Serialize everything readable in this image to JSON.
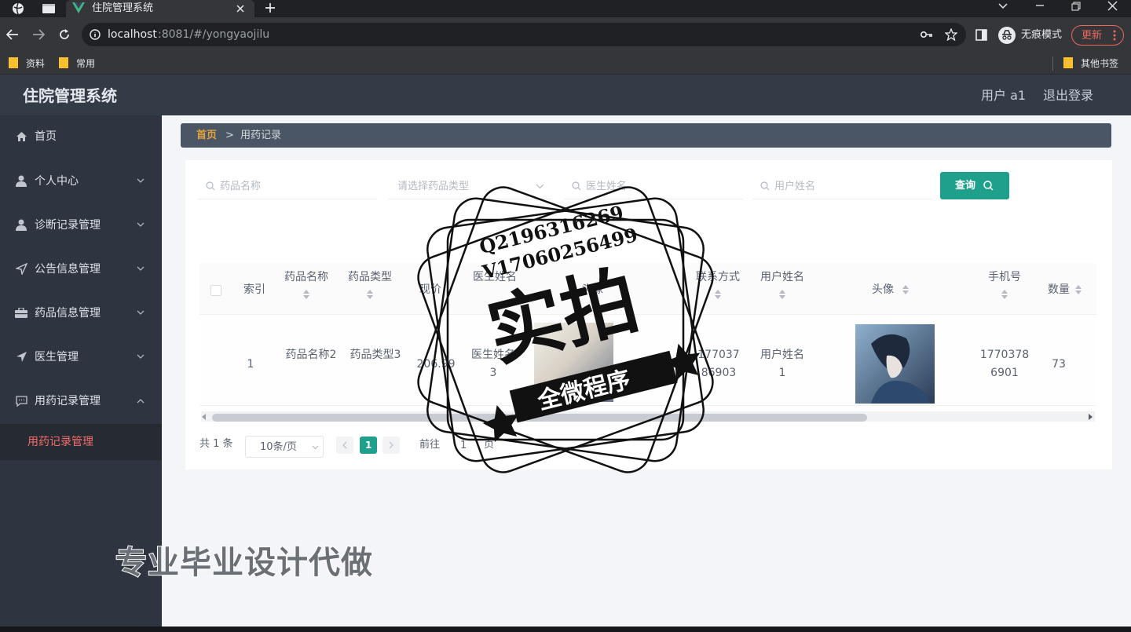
{
  "browser": {
    "tab_title": "住院管理系统",
    "url_host": "localhost",
    "url_rest": ":8081/#/yongyaojilu",
    "incognito_label": "无痕模式",
    "update_label": "更新",
    "bookmarks": [
      "资料",
      "常用"
    ],
    "other_bookmarks": "其他书签",
    "icons": [
      "globe-icon",
      "window-icon",
      "vue-logo-icon",
      "close-tab-icon",
      "new-tab-icon",
      "minimize-icon",
      "restore-icon",
      "close-window-icon",
      "back-icon",
      "forward-icon",
      "reload-icon",
      "info-icon",
      "key-icon",
      "star-icon",
      "sidebar-icon",
      "incognito-icon",
      "more-icon",
      "folder-icon"
    ]
  },
  "app": {
    "title": "住院管理系统",
    "user_label": "用户 a1",
    "logout_label": "退出登录"
  },
  "sidebar": {
    "items": [
      {
        "label": "首页",
        "icon": "home-icon"
      },
      {
        "label": "个人中心",
        "icon": "user-icon"
      },
      {
        "label": "诊断记录管理",
        "icon": "user-icon"
      },
      {
        "label": "公告信息管理",
        "icon": "send-icon"
      },
      {
        "label": "药品信息管理",
        "icon": "briefcase-icon"
      },
      {
        "label": "医生管理",
        "icon": "plane-icon"
      },
      {
        "label": "用药记录管理",
        "icon": "chat-icon"
      }
    ],
    "sub_item": "用药记录管理",
    "colors": {
      "active": "#f56c6c"
    }
  },
  "breadcrumb": {
    "home": "首页",
    "separator": ">",
    "current": "用药记录"
  },
  "search": {
    "drug_name_placeholder": "药品名称",
    "drug_type_placeholder": "请选择药品类型",
    "doctor_placeholder": "医生姓名",
    "user_placeholder": "用户姓名",
    "query_label": "查询"
  },
  "table": {
    "headers": [
      "索引",
      "药品名称",
      "药品类型",
      "现价",
      "医生姓名",
      "头像",
      "联系方式",
      "用户姓名",
      "头像",
      "手机号",
      "数量"
    ],
    "rows": [
      {
        "index": "1",
        "drug_name": "药品名称2",
        "drug_type": "药品类型3",
        "price": "206.99",
        "doctor": "医生姓名3",
        "contact": "17703786903",
        "user": "用户姓名1",
        "phone": "17703786901",
        "quantity": "73"
      }
    ]
  },
  "pagination": {
    "total": "共 1 条",
    "page_size": "10条/页",
    "current_page": "1",
    "goto_prefix": "前往",
    "goto_value": "1",
    "goto_suffix": "页"
  },
  "watermark": {
    "qq": "Q2196316269",
    "v": "V17060256499",
    "big": "实拍",
    "banner": "全微程序",
    "caption": "专业毕业设计代做"
  },
  "colors": {
    "accent": "#1fa08d",
    "header": "#333b47",
    "sidebar": "#2f3540",
    "breadcrumb_home": "#e5a43a"
  }
}
